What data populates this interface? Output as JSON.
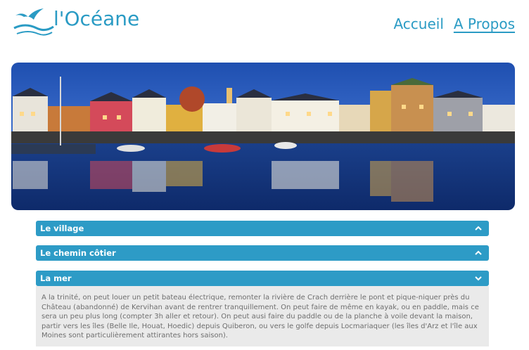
{
  "brand": {
    "name": "l'Océane",
    "accent": "#2d9bc6",
    "logo_icon": "seagull-wave-icon"
  },
  "nav": {
    "items": [
      {
        "label": "Accueil"
      },
      {
        "label": "A Propos"
      }
    ]
  },
  "hero": {
    "image": "harbor-night-panorama"
  },
  "sections": [
    {
      "title": "Le village",
      "state": "collapsed",
      "icon": "chevron-up-icon"
    },
    {
      "title": "Le chemin côtier",
      "state": "collapsed",
      "icon": "chevron-up-icon"
    },
    {
      "title": "La mer",
      "state": "expanded",
      "icon": "chevron-down-icon",
      "body": "A la trinité, on peut louer un petit bateau électrique, remonter la rivière de Crach derrière le pont et pique-niquer près du Château (abandonné) de Kervihan avant de rentrer tranquillement. On peut faire de même en kayak, ou en paddle, mais ce sera un peu plus long (compter 3h aller et retour). On peut ausi faire du paddle ou de la planche à voile devant la maison, partir vers les îles (Belle Ile, Houat, Hoedic) depuis Quiberon, ou vers le golfe depuis Locmariaquer (les îles d'Arz et l'île aux Moines sont particulièrement attirantes hors saison)."
    }
  ]
}
